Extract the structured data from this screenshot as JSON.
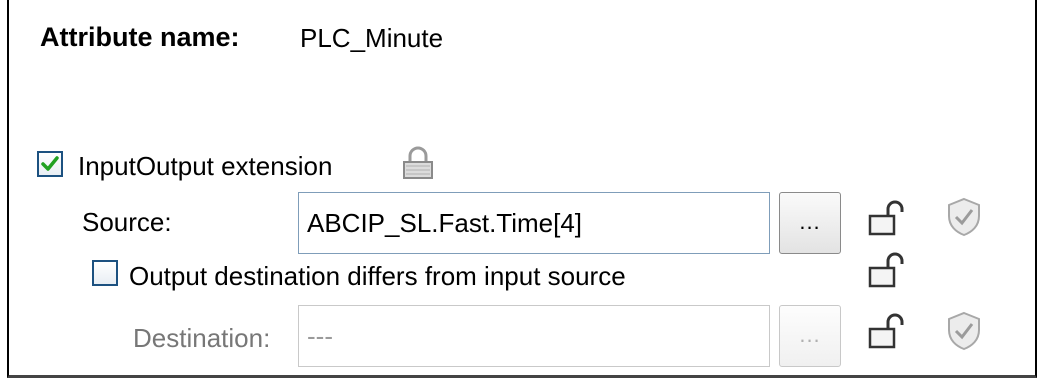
{
  "attribute": {
    "label": "Attribute name:",
    "value": "PLC_Minute"
  },
  "inputoutput": {
    "label": "InputOutput extension",
    "checked": true
  },
  "source": {
    "label": "Source:",
    "value": "ABCIP_SL.Fast.Time[4]",
    "browse_label": "..."
  },
  "output_diff": {
    "label": "Output destination differs from input source",
    "checked": false
  },
  "destination": {
    "label": "Destination:",
    "value": "---",
    "browse_label": "..."
  }
}
